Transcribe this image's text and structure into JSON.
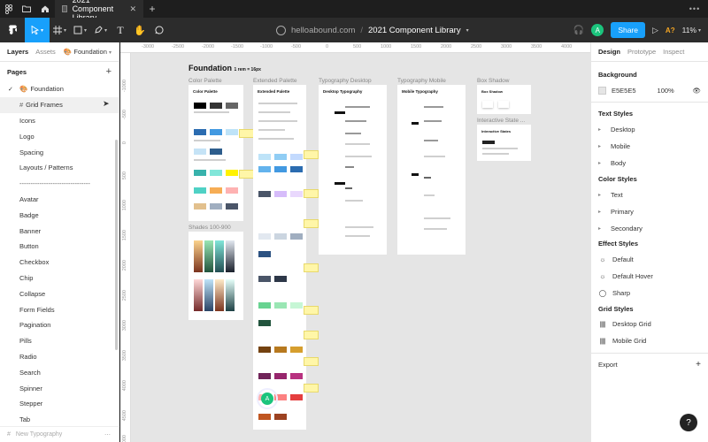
{
  "titlebar": {
    "tab_title": "2021 Component Library"
  },
  "toolbar": {
    "team": "helloabound.com",
    "separator": "/",
    "file_name": "2021 Component Library",
    "share_label": "Share",
    "avatar_initial": "A",
    "ai_label": "A?",
    "zoom": "11%"
  },
  "left": {
    "tab_layers": "Layers",
    "tab_assets": "Assets",
    "page_selector": "Foundation",
    "pages_heading": "Pages",
    "pages": [
      "Foundation",
      "Grid Frames",
      "Icons",
      "Logo",
      "Spacing",
      "Layouts / Patterns",
      "--------------------------------",
      "Avatar",
      "Badge",
      "Banner",
      "Button",
      "Checkbox",
      "Chip",
      "Collapse",
      "Form Fields",
      "Pagination",
      "Pills",
      "Radio",
      "Search",
      "Spinner",
      "Stepper",
      "Tab"
    ],
    "footer": "New Typography"
  },
  "canvas": {
    "ruler_top": [
      "-3000",
      "-2500",
      "-2000",
      "-1500",
      "-1000",
      "-500",
      "0",
      "500",
      "1000",
      "1500",
      "2000",
      "2500",
      "3000",
      "3500",
      "4000"
    ],
    "ruler_left": [
      "-1000",
      "-500",
      "0",
      "500",
      "1000",
      "1500",
      "2000",
      "2500",
      "3000",
      "3500",
      "4000",
      "4500",
      "5000"
    ],
    "page_title": "Foundation",
    "page_subtitle": "1 rem = 16px",
    "frames": {
      "color_palette": "Color Palette",
      "extended_palette": "Extended Palette",
      "typography_desktop": "Typography Desktop",
      "typography_mobile": "Typography Mobile",
      "box_shadow": "Box Shadow",
      "interactive_state": "Interactive State ...",
      "shades": "Shades 100-900"
    },
    "frame_headers": {
      "color_palette": "Color Palette",
      "extended_palette": "Extended Palette",
      "desktop_typography": "Desktop Typography",
      "mobile_typography": "Mobile Typography",
      "box_shadow": "Box Shadow",
      "interactive_states": "Interactive States"
    },
    "avatar_initial": "A"
  },
  "right": {
    "tab_design": "Design",
    "tab_prototype": "Prototype",
    "tab_inspect": "Inspect",
    "background_heading": "Background",
    "background_hex": "E5E5E5",
    "background_opacity": "100%",
    "text_styles_heading": "Text Styles",
    "text_styles": [
      "Desktop",
      "Mobile",
      "Body"
    ],
    "color_styles_heading": "Color Styles",
    "color_styles": [
      "Text",
      "Primary",
      "Secondary"
    ],
    "effect_styles_heading": "Effect Styles",
    "effect_styles": [
      "Default",
      "Default Hover",
      "Sharp"
    ],
    "grid_styles_heading": "Grid Styles",
    "grid_styles": [
      "Desktop Grid",
      "Mobile Grid"
    ],
    "export_heading": "Export"
  },
  "colors": {
    "accent": "#18a0fb",
    "canvas_bg": "#e5e5e5",
    "avatar": "#1bc47d"
  }
}
